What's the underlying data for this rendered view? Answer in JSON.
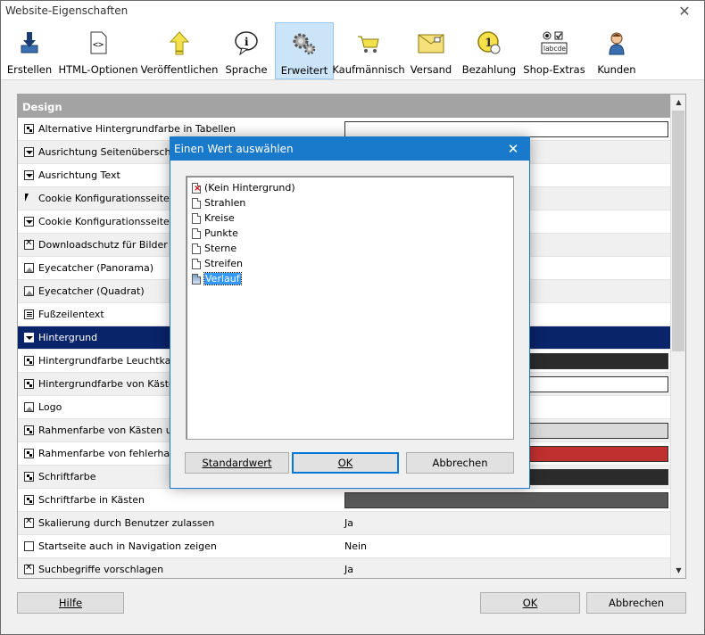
{
  "window": {
    "title": "Website-Eigenschaften",
    "close_label": "✕"
  },
  "toolbar": {
    "items": [
      {
        "label": "Erstellen",
        "icon": "download-icon"
      },
      {
        "label": "HTML-Optionen",
        "icon": "html-code-icon"
      },
      {
        "label": "Veröffentlichen",
        "icon": "upload-arrow-icon"
      },
      {
        "label": "Sprache",
        "icon": "info-speech-icon"
      },
      {
        "label": "Erweitert",
        "icon": "gears-icon",
        "active": true
      },
      {
        "label": "Kaufmännisch",
        "icon": "shopping-cart-icon"
      },
      {
        "label": "Versand",
        "icon": "envelope-icon"
      },
      {
        "label": "Bezahlung",
        "icon": "coin-icon"
      },
      {
        "label": "Shop-Extras",
        "icon": "form-controls-icon",
        "icon_text": "labcde"
      },
      {
        "label": "Kunden",
        "icon": "person-icon"
      }
    ]
  },
  "grid": {
    "section_title": "Design",
    "rows": [
      {
        "label": "Alternative Hintergrundfarbe in Tabellen",
        "icon": "color",
        "value": "",
        "swatch": "#ffffff"
      },
      {
        "label": "Ausrichtung Seitenüberschrift",
        "icon": "dropdown",
        "value": ""
      },
      {
        "label": "Ausrichtung Text",
        "icon": "dropdown",
        "value": ""
      },
      {
        "label": "Cookie Konfigurationsseite",
        "icon": "cursor",
        "value": ""
      },
      {
        "label": "Cookie Konfigurationsseite Pos",
        "icon": "dropdown",
        "value": ""
      },
      {
        "label": "Downloadschutz für Bilder",
        "icon": "check",
        "value": ""
      },
      {
        "label": "Eyecatcher (Panorama)",
        "icon": "image",
        "value": ""
      },
      {
        "label": "Eyecatcher (Quadrat)",
        "icon": "image",
        "value": ""
      },
      {
        "label": "Fußzeilentext",
        "icon": "lines",
        "value": ""
      },
      {
        "label": "Hintergrund",
        "icon": "dropdown",
        "value": "",
        "selected": true
      },
      {
        "label": "Hintergrundfarbe Leuchtkasten",
        "icon": "color",
        "value": "",
        "swatch": "#2b2b2b"
      },
      {
        "label": "Hintergrundfarbe von Kästen u",
        "icon": "color",
        "value": "",
        "swatch": "#ffffff"
      },
      {
        "label": "Logo",
        "icon": "image",
        "value": ""
      },
      {
        "label": "Rahmenfarbe von Kästen und T",
        "icon": "color",
        "value": "",
        "swatch": "#d9d9d9"
      },
      {
        "label": "Rahmenfarbe von fehlerhaften",
        "icon": "color",
        "value": "",
        "swatch": "#c0302f"
      },
      {
        "label": "Schriftfarbe",
        "icon": "color",
        "value": "",
        "swatch": "#2b2b2b"
      },
      {
        "label": "Schriftfarbe in Kästen",
        "icon": "color",
        "value": "",
        "swatch": "#585858"
      },
      {
        "label": "Skalierung durch Benutzer zulassen",
        "icon": "check",
        "value": "Ja"
      },
      {
        "label": "Startseite auch in Navigation zeigen",
        "icon": "empty",
        "value": "Nein"
      },
      {
        "label": "Suchbegriffe vorschlagen",
        "icon": "check",
        "value": "Ja"
      }
    ]
  },
  "buttons": {
    "help": "Hilfe",
    "ok": "OK",
    "cancel": "Abbrechen"
  },
  "dialog": {
    "title": "Einen Wert auswählen",
    "close_label": "✕",
    "options": [
      {
        "label": "(Kein Hintergrund)",
        "icon": "none"
      },
      {
        "label": "Strahlen",
        "icon": "file"
      },
      {
        "label": "Kreise",
        "icon": "file"
      },
      {
        "label": "Punkte",
        "icon": "file"
      },
      {
        "label": "Sterne",
        "icon": "file"
      },
      {
        "label": "Streifen",
        "icon": "file"
      },
      {
        "label": "Verlauf",
        "icon": "gradient",
        "selected": true
      }
    ],
    "buttons": {
      "default": "Standardwert",
      "ok": "OK",
      "cancel": "Abbrechen"
    }
  },
  "colors": {
    "selection_row": "#0a246a",
    "dialog_accent": "#1979ca",
    "list_selection": "#3399ff"
  }
}
